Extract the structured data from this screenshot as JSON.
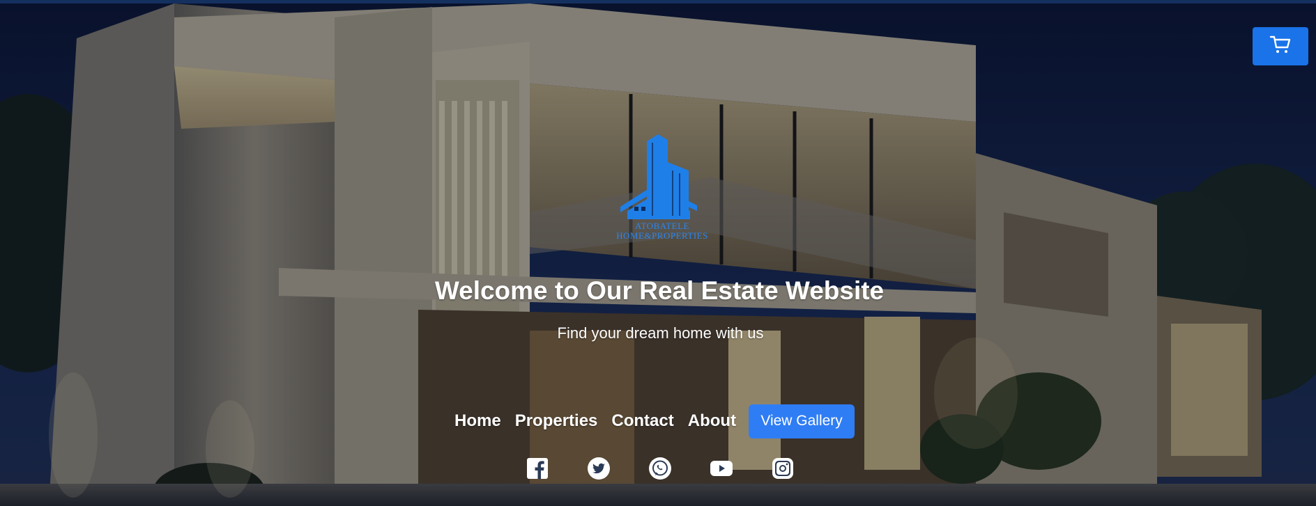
{
  "hero": {
    "headline": "Welcome to Our Real Estate Website",
    "tagline": "Find your dream home with us"
  },
  "logo": {
    "line1": "ATOBATELE",
    "line2": "HOME&PROPERTIES",
    "icon": "building-house-logo-icon"
  },
  "cart": {
    "icon": "cart-icon"
  },
  "nav": {
    "items": [
      {
        "label": "Home"
      },
      {
        "label": "Properties"
      },
      {
        "label": "Contact"
      },
      {
        "label": "About"
      }
    ],
    "gallery_button": "View Gallery"
  },
  "social": {
    "icons": [
      "facebook-icon",
      "twitter-icon",
      "whatsapp-icon",
      "youtube-icon",
      "instagram-icon"
    ]
  },
  "colors": {
    "accent": "#1a73e8",
    "button": "#2f7df4",
    "logo": "#2a86f0",
    "text": "#ffffff"
  }
}
